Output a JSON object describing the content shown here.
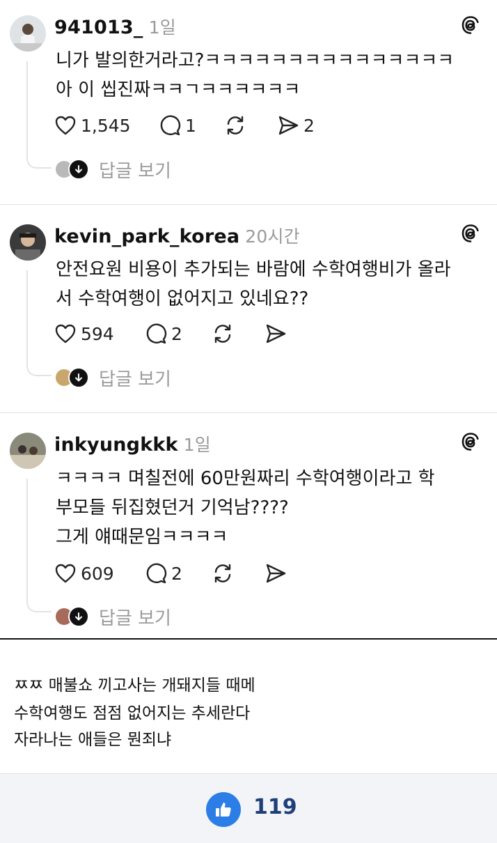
{
  "posts": [
    {
      "username": "941013_",
      "time": "1일",
      "lines": [
        "니가 발의한거라고?ㅋㅋㅋㅋㅋㅋㅋㅋㅋㅋㅋㅋㅋㅋㅋ",
        "아 이 씹진짜ㅋㅋㄱㅋㅋㅋㅋㅋㅋ"
      ],
      "likes": "1,545",
      "comments": "1",
      "shares": "2",
      "replies_label": "답글 보기"
    },
    {
      "username": "kevin_park_korea",
      "time": "20시간",
      "lines": [
        "안전요원 비용이 추가되는 바람에 수학여행비가 올라",
        "서 수학여행이 없어지고 있네요??"
      ],
      "likes": "594",
      "comments": "2",
      "shares": "",
      "replies_label": "답글 보기"
    },
    {
      "username": "inkyungkkk",
      "time": "1일",
      "lines": [
        "ㅋㅋㅋㅋ 며칠전에 60만원짜리 수학여행이라고 학",
        "부모들 뒤집혔던거 기억남????",
        "그게 얘때문임ㅋㅋㅋㅋ"
      ],
      "likes": "609",
      "comments": "2",
      "shares": "",
      "replies_label": "답글 보기"
    }
  ],
  "caption": {
    "lines": [
      "ㅉㅉ 매불쇼 끼고사는 개돼지들 때메",
      "수학여행도 점점 없어지는 추세란다",
      "자라나는 애들은 뭔죄냐"
    ]
  },
  "footer": {
    "like_count": "119"
  },
  "icons": {
    "heart": "heart-icon",
    "comment": "comment-icon",
    "repost": "repost-icon",
    "share": "send-icon",
    "threads": "threads-logo-icon",
    "thumbs_up": "thumbs-up-icon"
  },
  "colors": {
    "like_button": "#2c7ee6",
    "like_count": "#1f3f7a",
    "muted_text": "#9a9a9a"
  }
}
